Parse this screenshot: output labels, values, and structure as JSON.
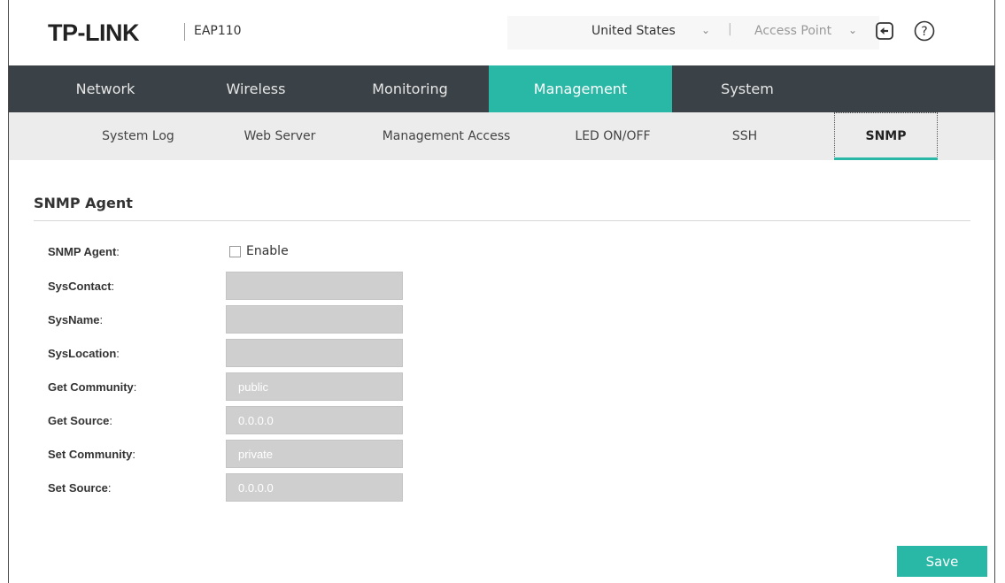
{
  "header": {
    "logo_text": "TP-LINK",
    "model": "EAP110",
    "country": "United States",
    "mode": "Access Point",
    "icons": {
      "logout": "logout-icon",
      "help": "help-icon"
    }
  },
  "main_nav": [
    {
      "label": "Network",
      "active": false
    },
    {
      "label": "Wireless",
      "active": false
    },
    {
      "label": "Monitoring",
      "active": false
    },
    {
      "label": "Management",
      "active": true
    },
    {
      "label": "System",
      "active": false
    }
  ],
  "sub_nav": [
    {
      "label": "System Log",
      "active": false
    },
    {
      "label": "Web Server",
      "active": false
    },
    {
      "label": "Management Access",
      "active": false
    },
    {
      "label": "LED ON/OFF",
      "active": false
    },
    {
      "label": "SSH",
      "active": false
    },
    {
      "label": "SNMP",
      "active": true
    }
  ],
  "section": {
    "title": "SNMP Agent"
  },
  "form": {
    "snmp_agent": {
      "label": "SNMP Agent",
      "checkbox_label": "Enable",
      "checked": false
    },
    "fields": [
      {
        "label": "SysContact",
        "value": ""
      },
      {
        "label": "SysName",
        "value": ""
      },
      {
        "label": "SysLocation",
        "value": ""
      },
      {
        "label": "Get Community",
        "value": "public"
      },
      {
        "label": "Get Source",
        "value": "0.0.0.0"
      },
      {
        "label": "Set Community",
        "value": "private"
      },
      {
        "label": "Set Source",
        "value": "0.0.0.0"
      }
    ]
  },
  "actions": {
    "save_label": "Save"
  },
  "colors": {
    "accent": "#29b8a5",
    "nav_bg": "#3b4247",
    "subnav_bg": "#ececec",
    "disabled_field_bg": "#cfcfcf"
  }
}
